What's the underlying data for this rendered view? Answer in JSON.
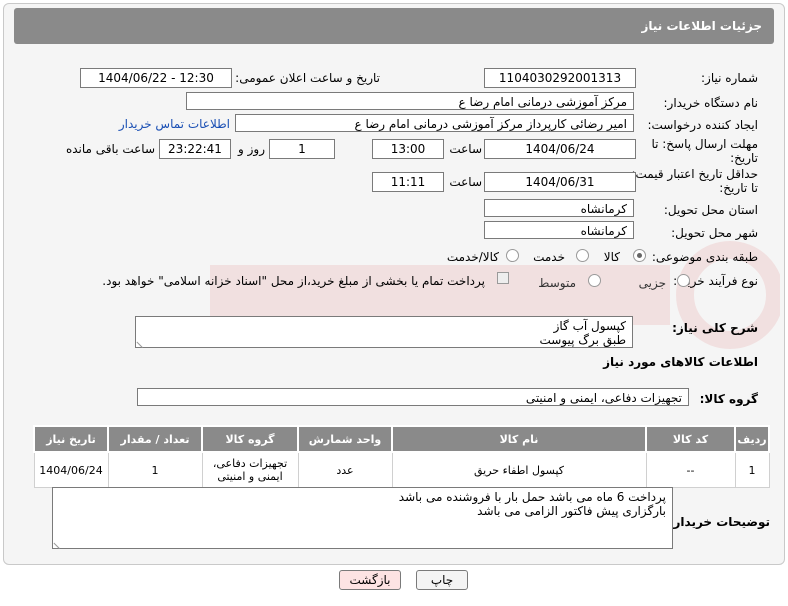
{
  "header": {
    "title": "جزئیات اطلاعات نیاز"
  },
  "fields": {
    "need_number_label": "شماره نیاز:",
    "need_number": "1104030292001313",
    "announce_label": "تاریخ و ساعت اعلان عمومی:",
    "announce_value": "1404/06/22 - 12:30",
    "buyer_org_label": "نام دستگاه خریدار:",
    "buyer_org": "مرکز آموزشی  درمانی امام رضا  ع",
    "creator_label": "ایجاد کننده درخواست:",
    "creator": "امیر رضائی کارپرداز مرکز آموزشی  درمانی امام رضا  ع",
    "contact_link": "اطلاعات تماس خریدار",
    "deadline_label_1": "مهلت ارسال پاسخ: تا",
    "deadline_label_2": "تاریخ:",
    "deadline_date": "1404/06/24",
    "time_label": "ساعت",
    "deadline_time": "13:00",
    "days_value": "1",
    "days_label": "روز و",
    "remaining_time": "23:22:41",
    "remaining_label": "ساعت باقی مانده",
    "min_price_label_1": "حداقل تاریخ اعتبار قیمت:",
    "min_price_label_2": "تا تاریخ:",
    "min_price_date": "1404/06/31",
    "min_price_time_label": "ساعت",
    "min_price_time": "11:11",
    "province_label": "استان محل تحویل:",
    "province": "کرمانشاه",
    "city_label": "شهر محل تحویل:",
    "city": "کرمانشاه",
    "category_label": "طبقه بندی موضوعی:",
    "category_options": [
      "کالا",
      "خدمت",
      "کالا/خدمت"
    ],
    "process_label": "نوع فرآیند خرید :",
    "process_options": [
      "جزیی",
      "متوسط"
    ],
    "payment_note": "پرداخت تمام یا بخشی از مبلغ خرید،از محل \"اسناد خزانه اسلامی\" خواهد بود.",
    "description_label": "شرح کلی نیاز:",
    "description_lines": [
      "کپسول آب گاز",
      "طبق برگ پیوست"
    ],
    "goods_info_title": "اطلاعات کالاهای مورد نیاز",
    "goods_group_label": "گروه کالا:",
    "goods_group": "تجهیزات دفاعی، ایمنی و امنیتی",
    "buyer_notes_label": "توضیحات خریدار:",
    "buyer_notes_lines": [
      "پرداخت 6 ماه می باشد حمل بار با فروشنده می باشد",
      "بارگزاری پیش فاکتور الزامی می باشد"
    ]
  },
  "table": {
    "headers": [
      "ردیف",
      "کد کالا",
      "نام کالا",
      "واحد شمارش",
      "گروه کالا",
      "تعداد / مقدار",
      "تاریخ نیاز"
    ],
    "rows": [
      [
        "1",
        "--",
        "کپسول اطفاء حریق",
        "عدد",
        "تجهیزات دفاعی، ایمنی و امنیتی",
        "1",
        "1404/06/24"
      ]
    ]
  },
  "buttons": {
    "print": "چاپ",
    "back": "بازگشت"
  },
  "colors": {
    "header_bg": "#8a8a8a",
    "link": "#1a4fb4",
    "back_button": "#fde3e3"
  }
}
